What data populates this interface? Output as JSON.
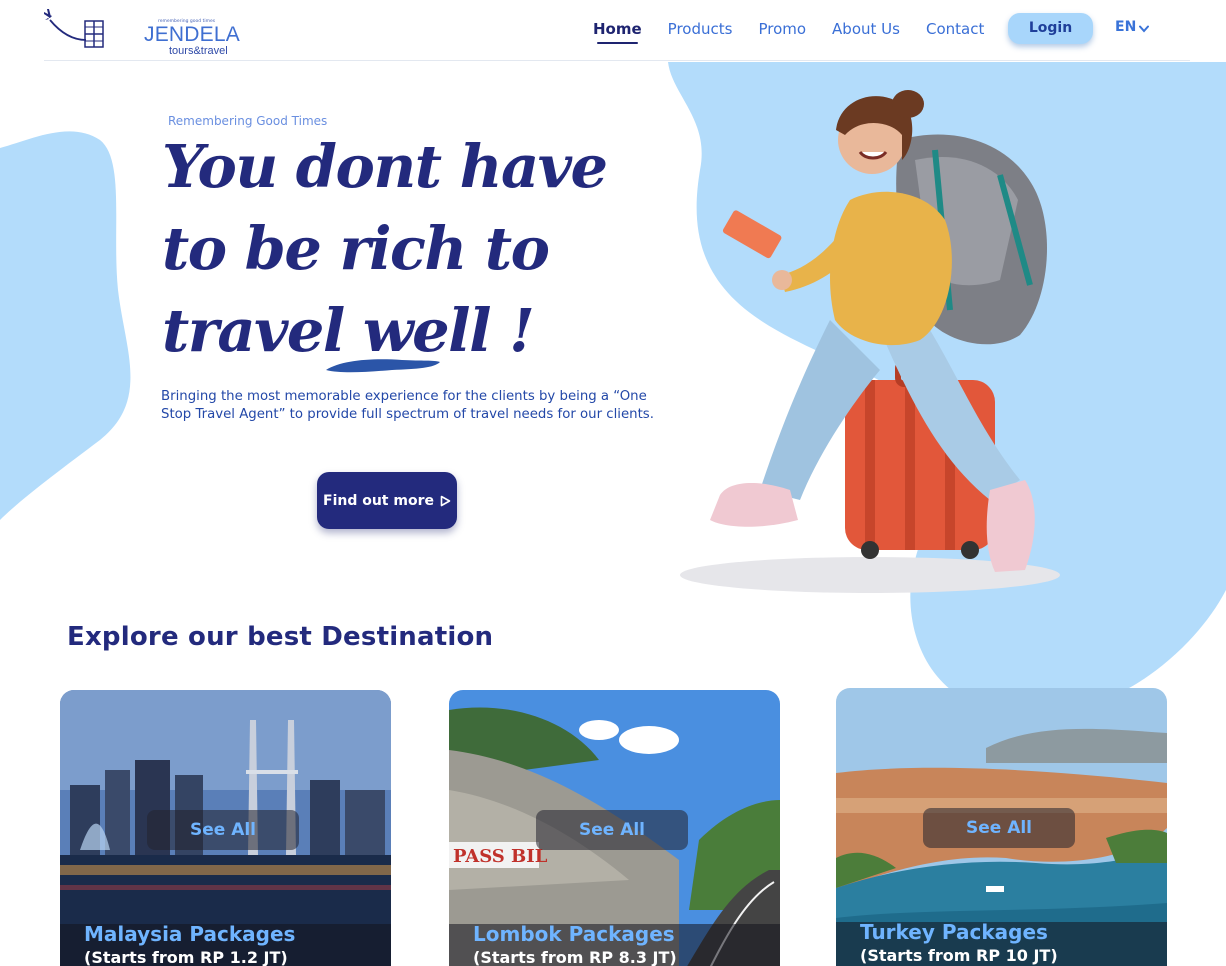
{
  "brand": {
    "tagline": "remembering good times",
    "name": "JENDELA",
    "sub": "tours&travel"
  },
  "nav": {
    "items": [
      {
        "label": "Home",
        "active": true
      },
      {
        "label": "Products",
        "active": false
      },
      {
        "label": "Promo",
        "active": false
      },
      {
        "label": "About Us",
        "active": false
      },
      {
        "label": "Contact",
        "active": false
      }
    ],
    "login_label": "Login",
    "language": "EN"
  },
  "hero": {
    "eyebrow": "Remembering Good Times",
    "title_lines": [
      "You dont have",
      "to be rich to",
      "travel well !"
    ],
    "description": "Bringing the most memorable experience for the clients by being a “One Stop Travel Agent” to provide full spectrum of travel needs for our clients.",
    "cta_label": "Find out more"
  },
  "destinations": {
    "heading": "Explore our best Destination",
    "cards": [
      {
        "title": "Malaysia Packages",
        "price": "(Starts from RP 1.2 JT)",
        "button": "See All"
      },
      {
        "title": "Lombok Packages",
        "price": "(Starts from RP 8.3 JT)",
        "button": "See All"
      },
      {
        "title": "Turkey Packages",
        "price": "(Starts from RP 10 JT)",
        "button": "See All"
      }
    ]
  },
  "colors": {
    "primary": "#232a7d",
    "accent": "#3a6fd6",
    "blob": "#b3dcfb",
    "login_bg": "#a8d6fb"
  },
  "icons": [
    "plane-icon",
    "window-icon",
    "chevron-down-icon",
    "play-arrow-icon"
  ]
}
